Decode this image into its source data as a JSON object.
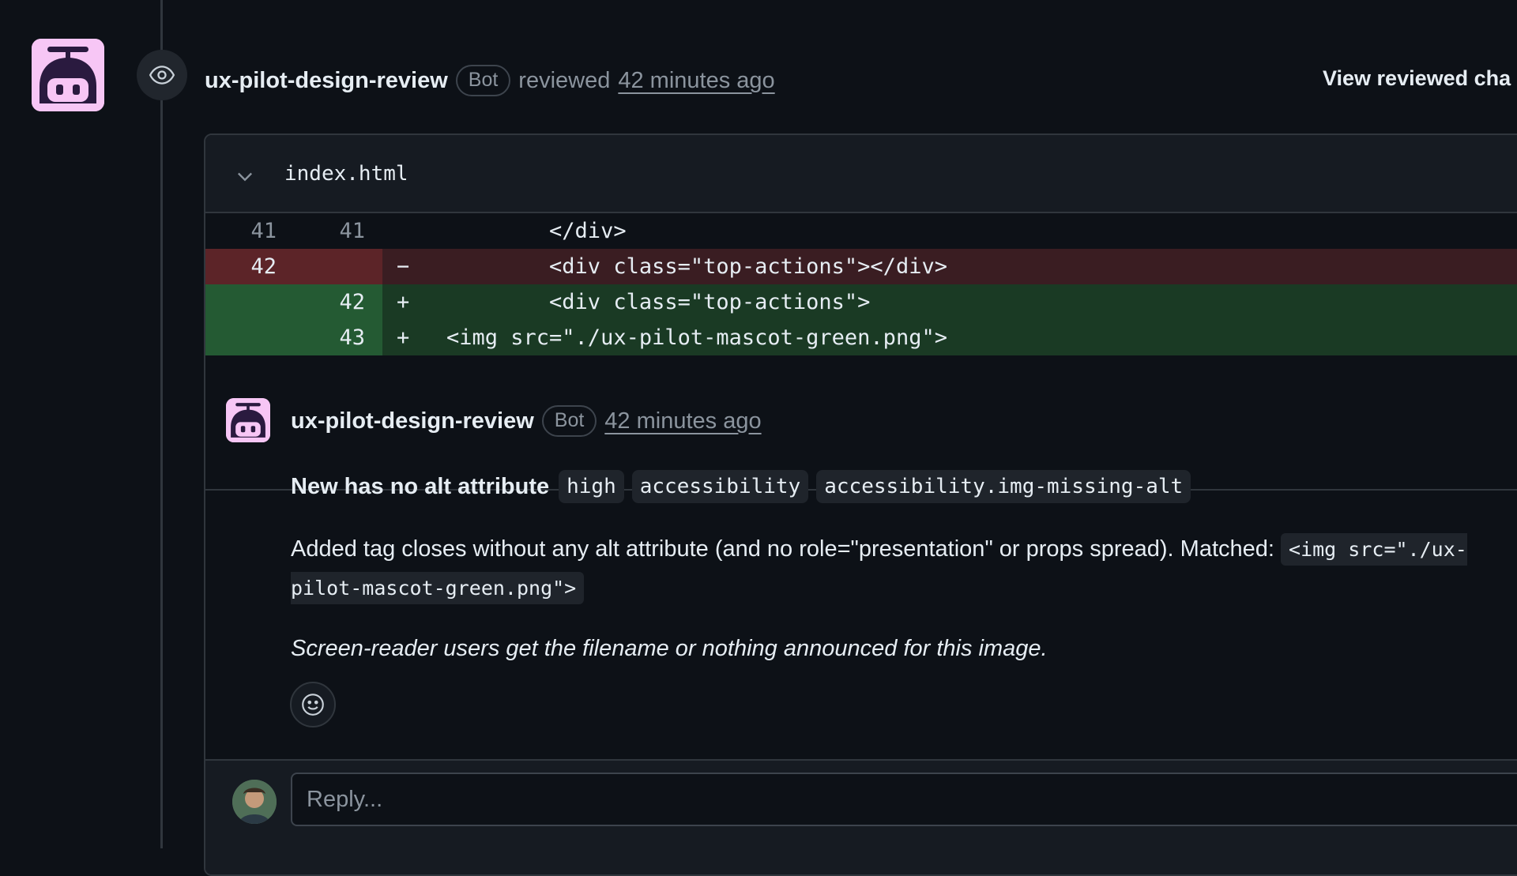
{
  "review": {
    "author": "ux-pilot-design-review",
    "bot_badge": "Bot",
    "action": "reviewed",
    "time": "42 minutes ago",
    "view_changes_label": "View reviewed cha"
  },
  "file": {
    "name": "index.html"
  },
  "diff_lines": [
    {
      "type": "context",
      "old": "41",
      "new": "41",
      "sign": "",
      "code": "        </div>"
    },
    {
      "type": "deletion",
      "old": "42",
      "new": "",
      "sign": "−",
      "code": "        <div class=\"top-actions\"></div>"
    },
    {
      "type": "addition",
      "old": "",
      "new": "42",
      "sign": "+",
      "code": "        <div class=\"top-actions\">"
    },
    {
      "type": "addition",
      "old": "",
      "new": "43",
      "sign": "+",
      "code": "<img src=\"./ux-pilot-mascot-green.png\">"
    }
  ],
  "comment": {
    "author": "ux-pilot-design-review",
    "bot_badge": "Bot",
    "time": "42 minutes ago",
    "title": "New  has no alt attribute",
    "tags": [
      "high",
      "accessibility",
      "accessibility.img-missing-alt"
    ],
    "body": "Added  tag closes without any alt attribute (and no role=\"presentation\" or props spread). Matched: ",
    "matched_code": "<img src=\"./ux-pilot-mascot-green.png\">",
    "note": "Screen-reader users get the filename or nothing announced for this image."
  },
  "reply": {
    "placeholder": "Reply..."
  },
  "colors": {
    "background": "#0d1117",
    "avatar_bg": "#f7c6f5",
    "deletion_bg": "#3a1d22",
    "addition_bg": "#1a3a24"
  },
  "icons": {
    "timeline": "eye-icon",
    "collapse": "chevron-down-icon",
    "reaction": "smiley-icon"
  }
}
